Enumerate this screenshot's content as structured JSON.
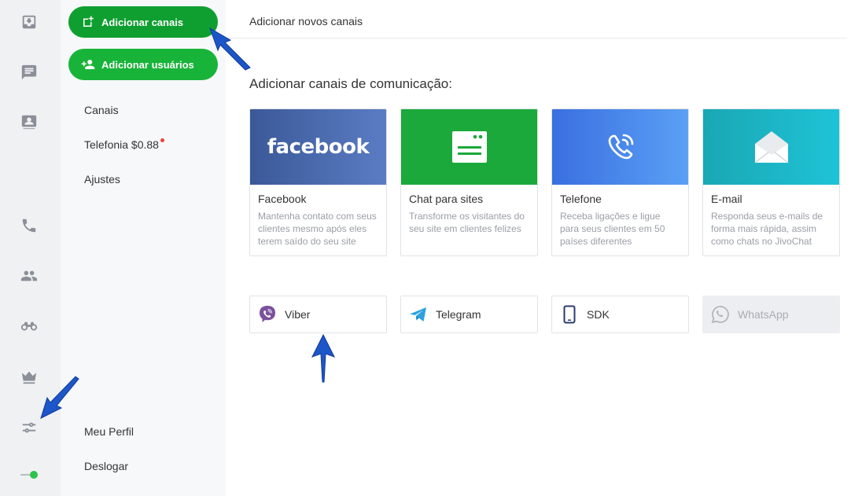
{
  "rail": {
    "icons": [
      "inbox-icon",
      "chat-icon",
      "contacts-card-icon",
      "phone-icon",
      "team-icon",
      "binoculars-icon",
      "crown-icon",
      "settings-sliders-icon",
      "status-toggle-icon"
    ],
    "status_color": "#2ec24c"
  },
  "sidebar": {
    "add_channels_label": "Adicionar canais",
    "add_users_label": "Adicionar usuários",
    "links": [
      "Canais",
      "Telefonia $0.88",
      "Ajustes"
    ],
    "bottom_links": [
      "Meu Perfil",
      "Deslogar"
    ]
  },
  "main": {
    "topbar_title": "Adicionar novos canais",
    "section_title": "Adicionar canais de comunicação:",
    "cards": [
      {
        "banner_text": "facebook",
        "title": "Facebook",
        "desc": "Mantenha contato com seus clientes mesmo após eles terem saído do seu site"
      },
      {
        "title": "Chat para sites",
        "desc": "Transforme os visitantes do seu site em clientes felizes"
      },
      {
        "title": "Telefone",
        "desc": "Receba ligações e ligue para seus clientes em 50 países diferentes"
      },
      {
        "title": "E-mail",
        "desc": "Responda seus e-mails de forma mais rápida, assim como chats no JivoChat"
      }
    ],
    "small_cards": [
      {
        "label": "Viber",
        "icon": "viber-icon"
      },
      {
        "label": "Telegram",
        "icon": "telegram-icon"
      },
      {
        "label": "SDK",
        "icon": "mobile-sdk-icon"
      },
      {
        "label": "WhatsApp",
        "icon": "whatsapp-icon",
        "disabled": true
      }
    ]
  },
  "colors": {
    "green": "#18b339",
    "facebook": "#3b5998",
    "arrow": "#1d56c8"
  }
}
